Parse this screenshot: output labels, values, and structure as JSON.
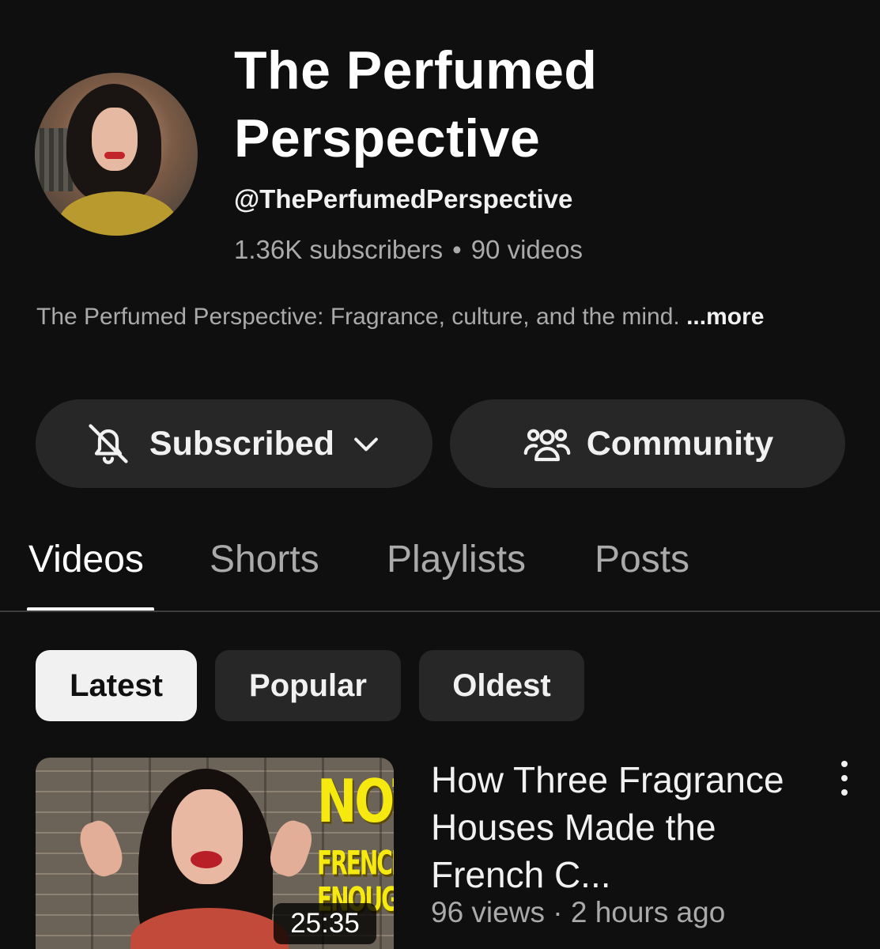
{
  "channel": {
    "title": "The  Perfumed Perspective",
    "handle": "@ThePerfumedPerspective",
    "subscribers": "1.36K subscribers",
    "separator": "•",
    "videos_count": "90 videos",
    "description": "The Perfumed Perspective: Fragrance, culture, and the mind.",
    "more_label": "...more"
  },
  "actions": {
    "subscribed_label": "Subscribed",
    "community_label": "Community"
  },
  "tabs": [
    {
      "label": "Videos",
      "active": true
    },
    {
      "label": "Shorts",
      "active": false
    },
    {
      "label": "Playlists",
      "active": false
    },
    {
      "label": "Posts",
      "active": false
    }
  ],
  "sort_chips": [
    {
      "label": "Latest",
      "active": true
    },
    {
      "label": "Popular",
      "active": false
    },
    {
      "label": "Oldest",
      "active": false
    }
  ],
  "videos": [
    {
      "title": "How Three Fragrance Houses Made the French C...",
      "views": "96 views",
      "meta_separator": "·",
      "age": "2 hours ago",
      "duration": "25:35",
      "thumbnail_text": [
        "NOT",
        "FRENCH",
        "ENOUGH"
      ]
    }
  ],
  "icons": {
    "subscribed": "bell-off-icon",
    "dropdown": "chevron-down-icon",
    "community": "people-icon",
    "menu": "more-vert-icon"
  },
  "colors": {
    "background": "#0f0f0f",
    "pill": "#272727",
    "chip_active": "#f1f1f1",
    "secondary_text": "#aaaaaa",
    "thumbnail_text": "#f5e90f"
  }
}
